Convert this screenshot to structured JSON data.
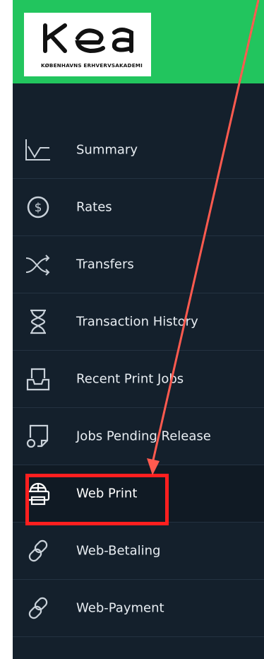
{
  "brand": {
    "logo_word": "KEA",
    "logo_subtitle": "KØBENHAVNS ERHVERVSAKADEMI",
    "bar_color": "#22c55e"
  },
  "sidebar": {
    "items": [
      {
        "label": "Summary",
        "icon": "line-chart-icon"
      },
      {
        "label": "Rates",
        "icon": "dollar-circle-icon"
      },
      {
        "label": "Transfers",
        "icon": "shuffle-icon"
      },
      {
        "label": "Transaction History",
        "icon": "hourglass-icon"
      },
      {
        "label": "Recent Print Jobs",
        "icon": "inbox-tray-icon"
      },
      {
        "label": "Jobs Pending Release",
        "icon": "printer-page-icon"
      },
      {
        "label": "Web Print",
        "icon": "globe-printer-icon",
        "active": true
      },
      {
        "label": "Web-Betaling",
        "icon": "link-chain-icon"
      },
      {
        "label": "Web-Payment",
        "icon": "link-chain-icon"
      }
    ]
  },
  "annotation": {
    "highlight_color": "#ff1f1f",
    "arrow_color": "#ff5a4f"
  }
}
